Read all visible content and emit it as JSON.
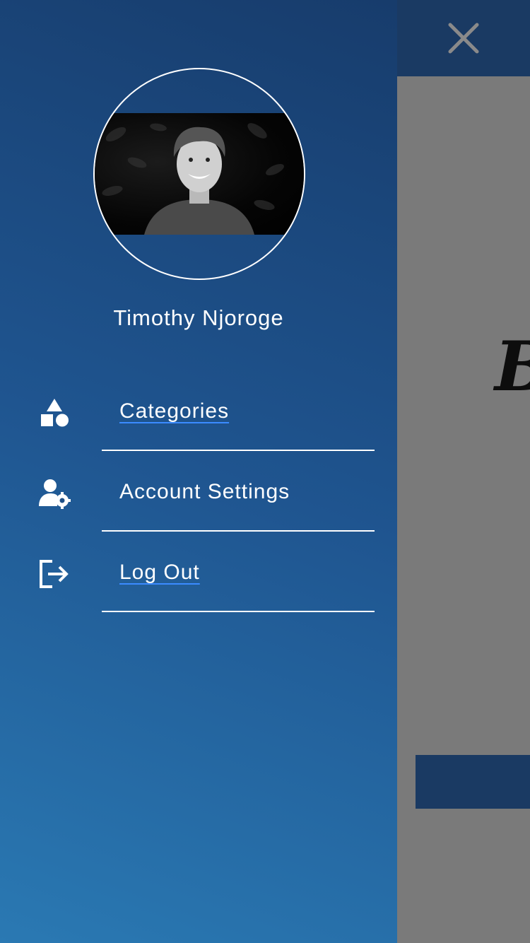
{
  "user": {
    "name": "Timothy Njoroge"
  },
  "menu": {
    "items": [
      {
        "label": "Categories",
        "icon": "shapes-icon"
      },
      {
        "label": "Account Settings",
        "icon": "user-cog-icon"
      },
      {
        "label": "Log Out",
        "icon": "logout-icon"
      }
    ]
  },
  "background": {
    "heading_fragment": "B"
  },
  "colors": {
    "drawer_top": "#173c6c",
    "drawer_bottom": "#2a79b3",
    "header": "#1a3a63",
    "overlay": "#7a7a7a",
    "link_underline": "#3b8bff"
  }
}
